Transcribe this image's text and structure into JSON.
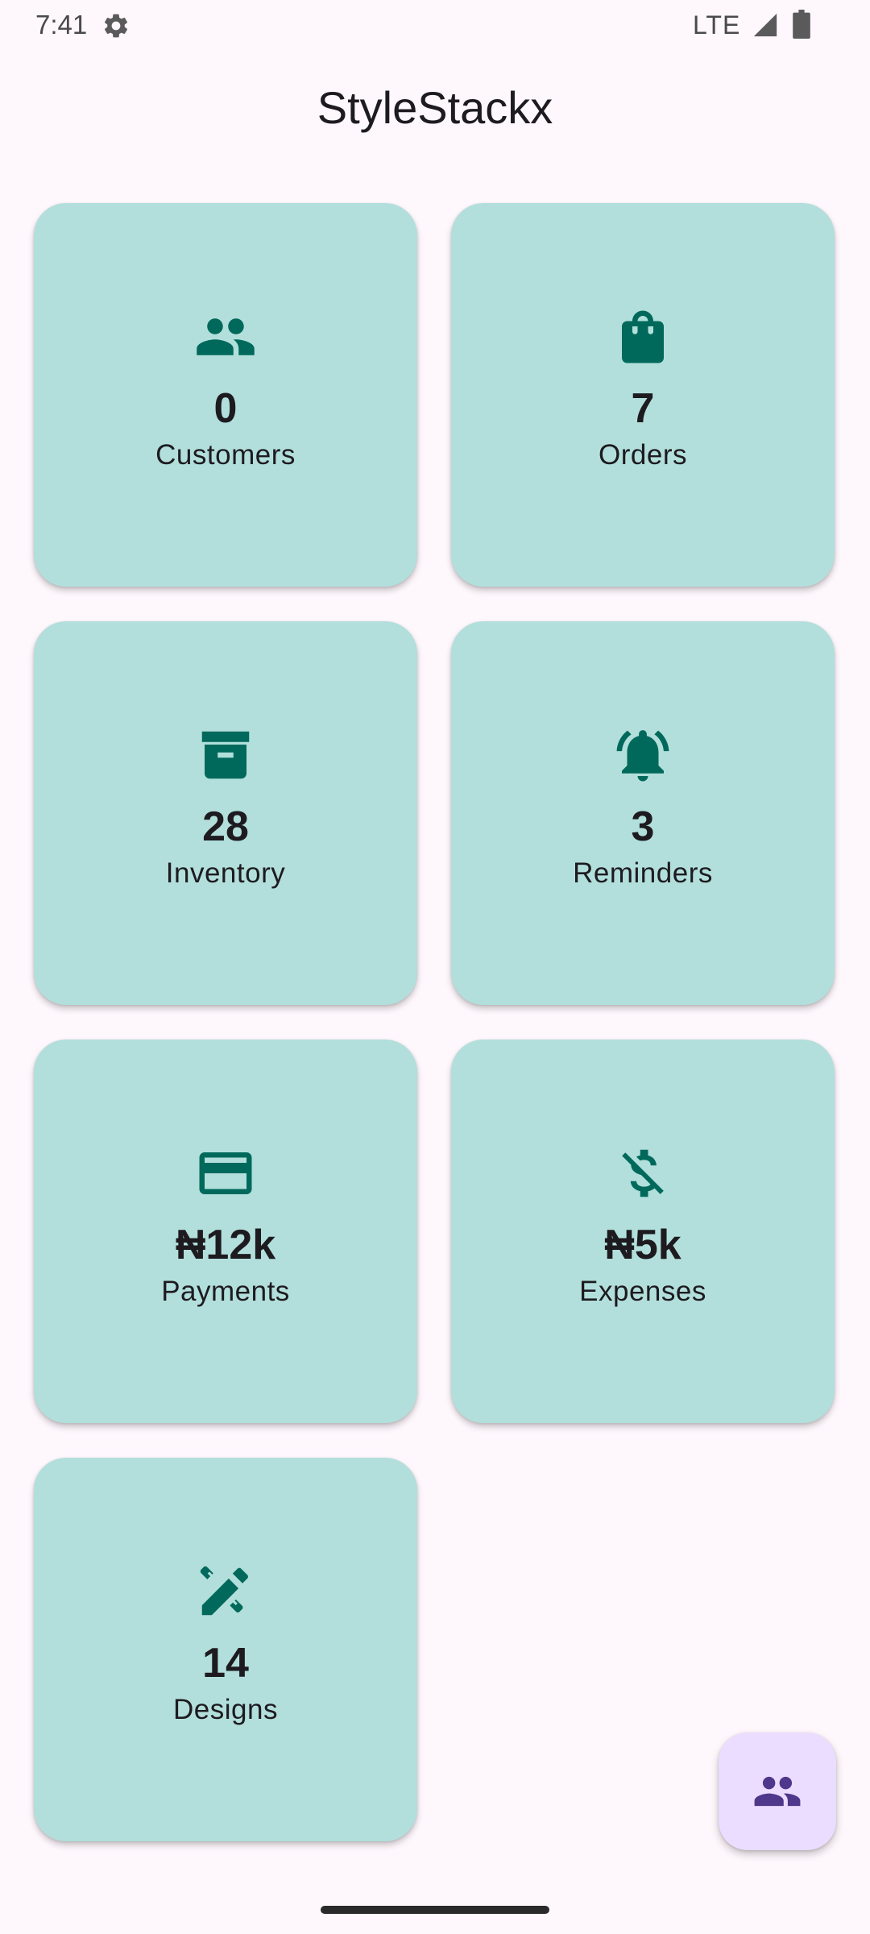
{
  "status_bar": {
    "time": "7:41",
    "network": "LTE",
    "icons": [
      "settings-gear-icon",
      "cell-signal-icon",
      "battery-icon"
    ]
  },
  "app_bar": {
    "title": "StyleStackx"
  },
  "colors": {
    "background": "#FEF7FC",
    "card": "#B2DFDB",
    "icon_accent": "#00695C",
    "fab_background": "#EADDFF",
    "fab_icon": "#4F378B"
  },
  "dashboard": {
    "cards": [
      {
        "icon": "people-icon",
        "value": "0",
        "label": "Customers"
      },
      {
        "icon": "shopping-bag-icon",
        "value": "7",
        "label": "Orders"
      },
      {
        "icon": "archive-box-icon",
        "value": "28",
        "label": "Inventory"
      },
      {
        "icon": "bell-ringing-icon",
        "value": "3",
        "label": "Reminders"
      },
      {
        "icon": "credit-card-icon",
        "value": "₦12k",
        "label": "Payments"
      },
      {
        "icon": "money-off-icon",
        "value": "₦5k",
        "label": "Expenses"
      },
      {
        "icon": "design-tools-icon",
        "value": "14",
        "label": "Designs"
      }
    ]
  },
  "fab": {
    "icon": "people-icon"
  }
}
